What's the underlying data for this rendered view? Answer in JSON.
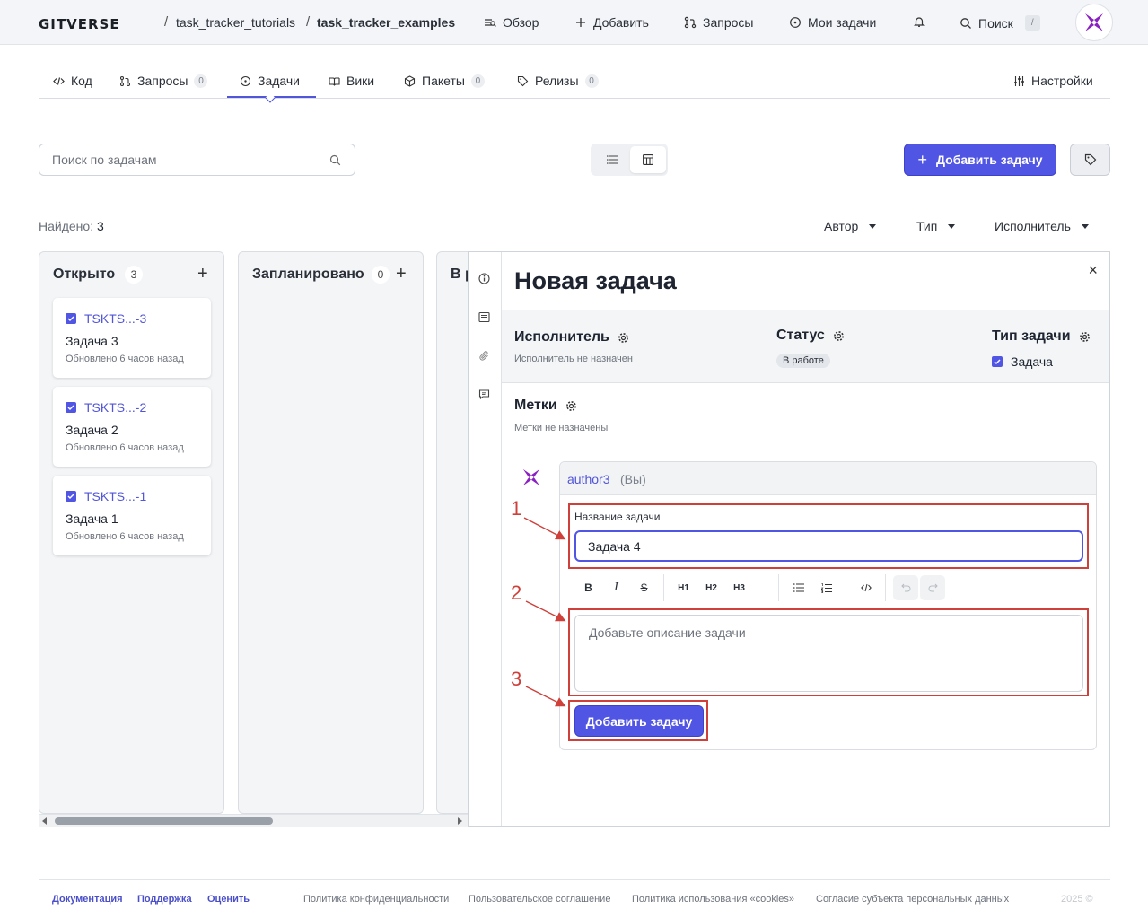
{
  "topbar": {
    "logo": "GITVERSE",
    "breadcrumb": [
      "task_tracker_tutorials",
      "task_tracker_examples"
    ],
    "separator": "/",
    "nav": {
      "overview": "Обзор",
      "add": "Добавить",
      "requests": "Запросы",
      "my_tasks": "Мои задачи",
      "search": "Поиск",
      "search_shortcut": "/"
    }
  },
  "tabs": [
    {
      "label": "Код"
    },
    {
      "label": "Запросы",
      "count": "0"
    },
    {
      "label": "Задачи",
      "active": true
    },
    {
      "label": "Вики"
    },
    {
      "label": "Пакеты",
      "count": "0"
    },
    {
      "label": "Релизы",
      "count": "0"
    }
  ],
  "settings_label": "Настройки",
  "toolbar": {
    "search_placeholder": "Поиск по задачам",
    "add_task_label": "Добавить задачу"
  },
  "found": {
    "label": "Найдено:",
    "value": "3"
  },
  "filters": [
    "Автор",
    "Тип",
    "Исполнитель"
  ],
  "board": {
    "columns": [
      {
        "title": "Открыто",
        "count": "3"
      },
      {
        "title": "Запланировано",
        "count": "0"
      },
      {
        "title": "В р"
      }
    ],
    "cards": [
      {
        "id": "TSKTS...-3",
        "title": "Задача 3",
        "updated": "Обновлено 6 часов назад"
      },
      {
        "id": "TSKTS...-2",
        "title": "Задача 2",
        "updated": "Обновлено 6 часов назад"
      },
      {
        "id": "TSKTS...-1",
        "title": "Задача 1",
        "updated": "Обновлено 6 часов назад"
      }
    ]
  },
  "panel": {
    "title": "Новая задача",
    "close": "×",
    "assignee": {
      "label": "Исполнитель",
      "value": "Исполнитель не назначен"
    },
    "status": {
      "label": "Статус",
      "value": "В работе"
    },
    "task_type": {
      "label": "Тип задачи",
      "value": "Задача"
    },
    "labels": {
      "label": "Метки",
      "value": "Метки не назначены"
    },
    "form": {
      "author": "author3",
      "you": "(Вы)",
      "name_label": "Название задачи",
      "name_value": "Задача 4",
      "toolbar": [
        "B",
        "I",
        "S",
        "H1",
        "H2",
        "H3"
      ],
      "desc_placeholder": "Добавьте описание задачи",
      "submit": "Добавить задачу"
    }
  },
  "annotations": [
    "1",
    "2",
    "3"
  ],
  "footer": {
    "links_left": [
      "Документация",
      "Поддержка",
      "Оценить"
    ],
    "links_right": [
      "Политика конфиденциальности",
      "Пользовательское соглашение",
      "Политика использования «cookies»",
      "Согласие субъекта персональных данных"
    ],
    "copyright": "2025 ©"
  },
  "colors": {
    "accent": "#5155e3",
    "annotation": "#d0403a",
    "brand_logo": "#8a1fc2"
  }
}
